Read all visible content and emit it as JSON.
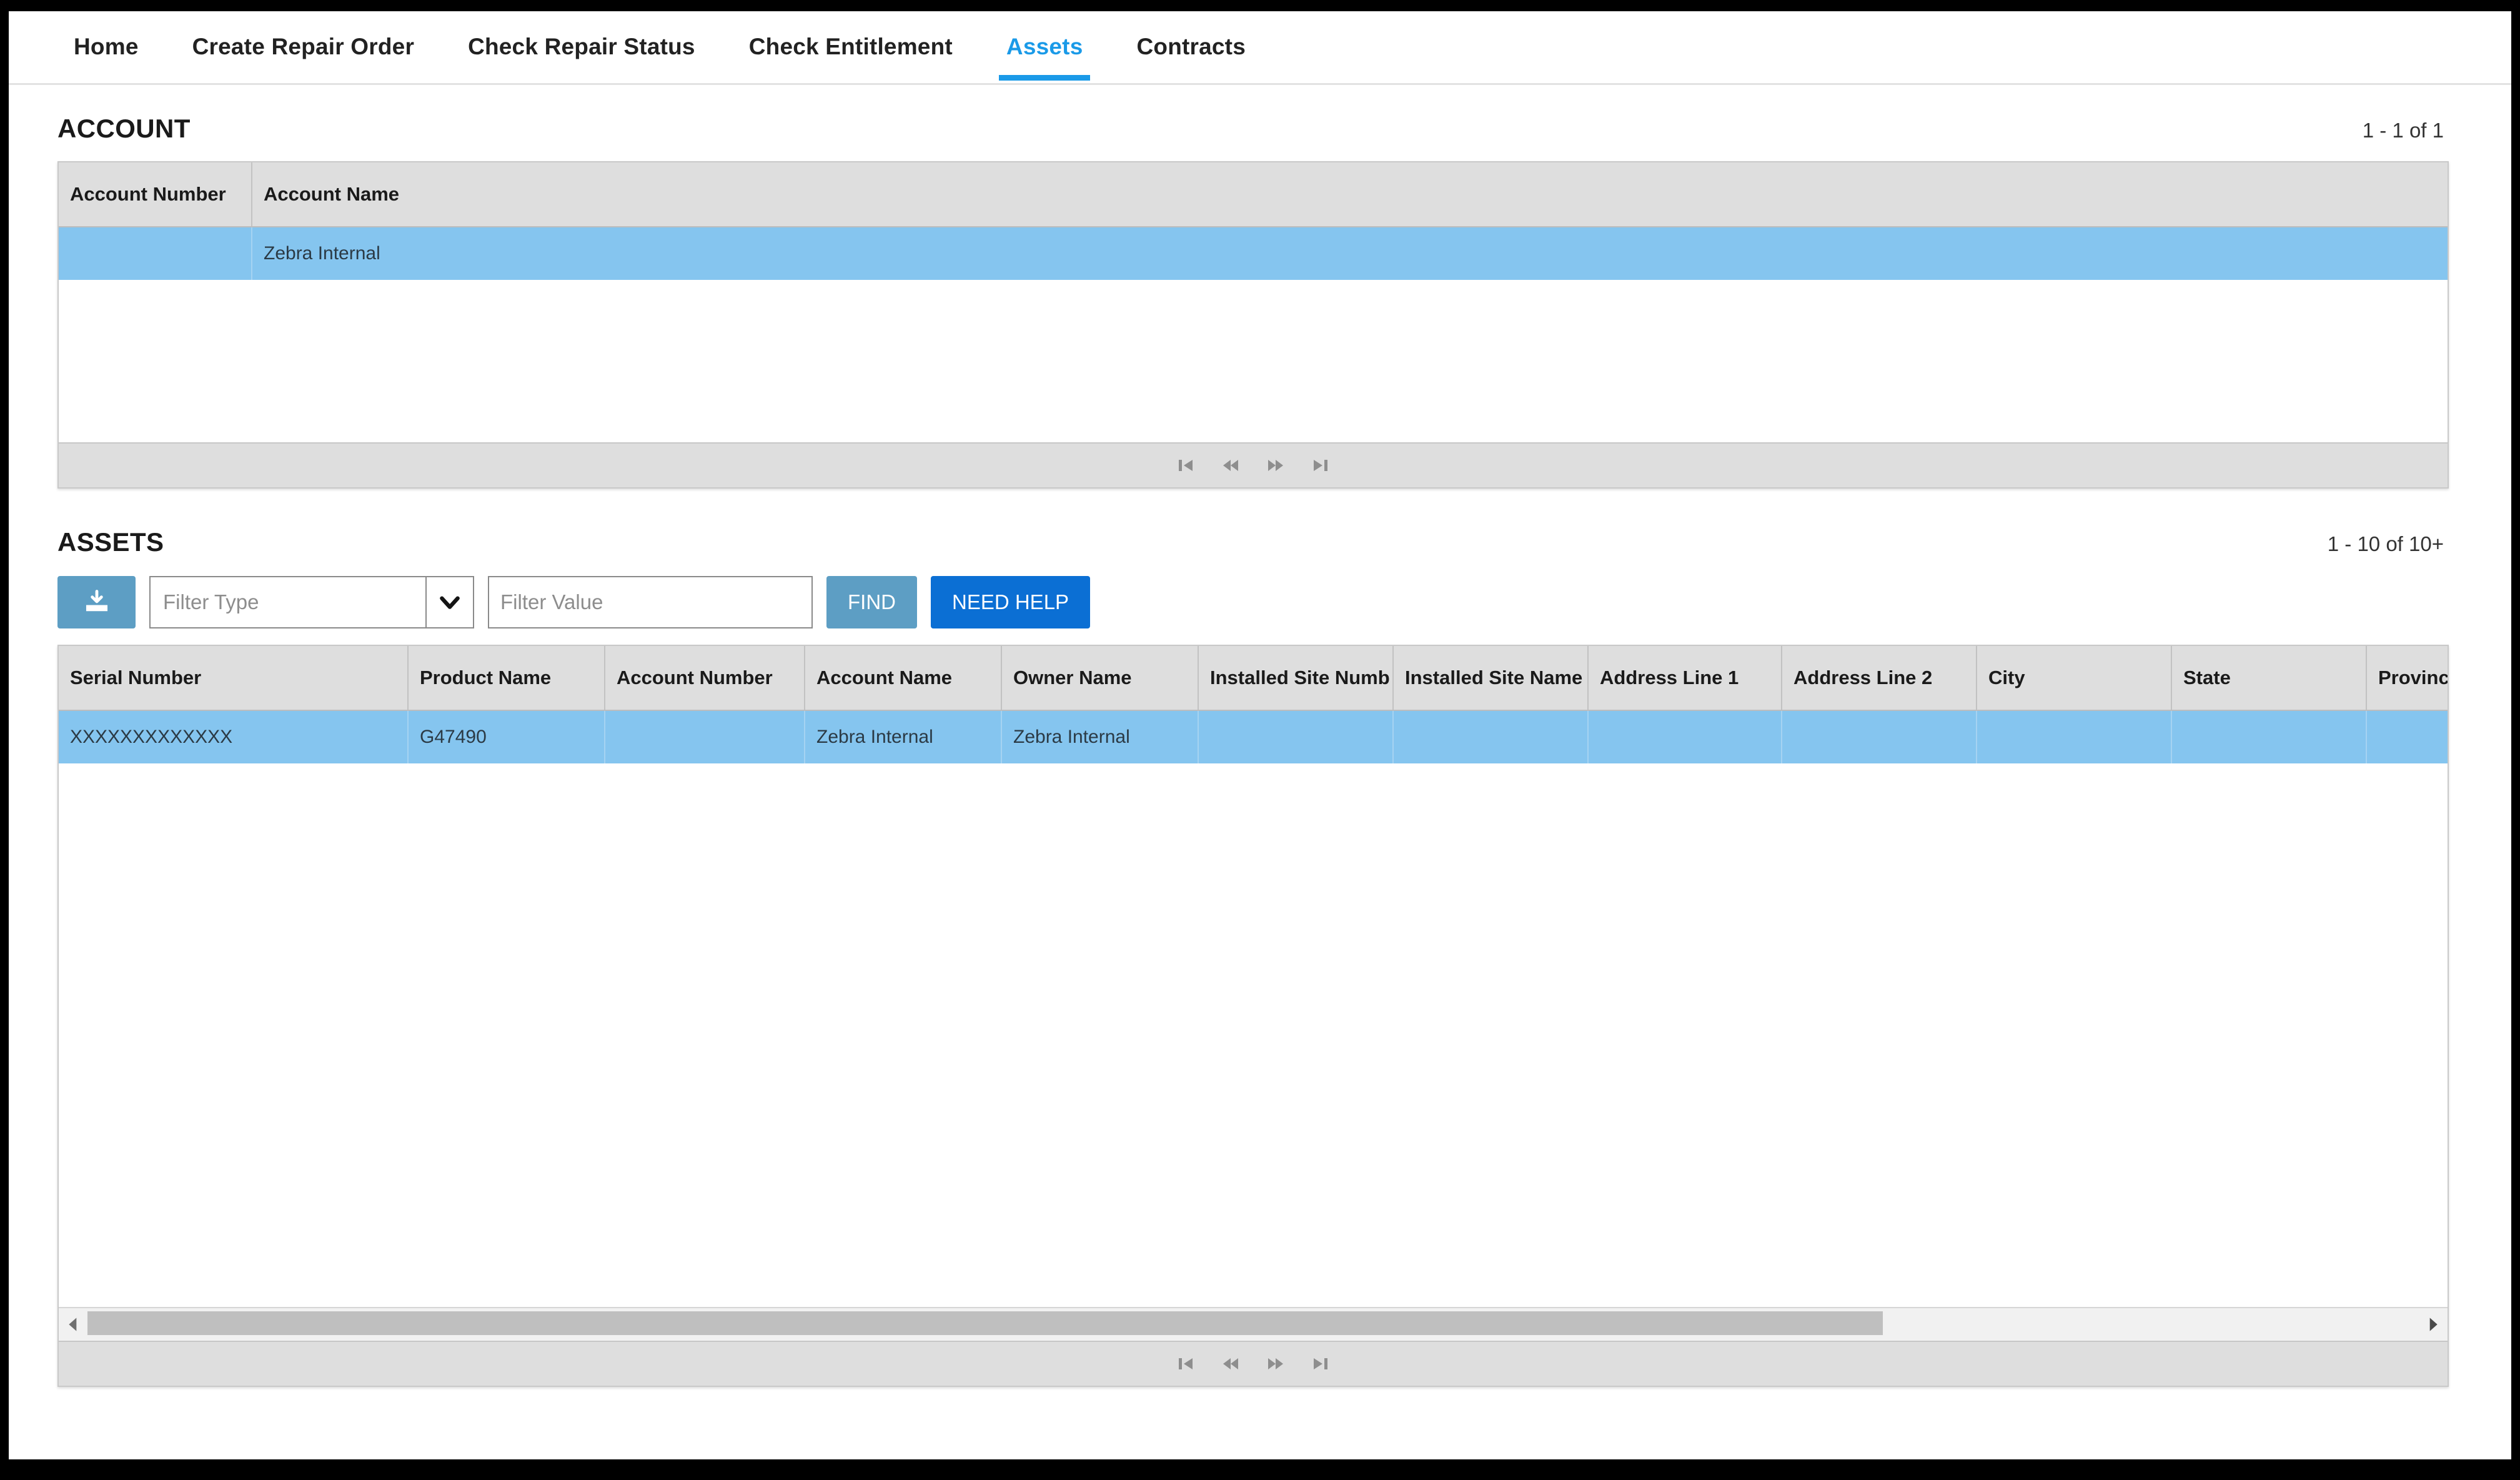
{
  "nav": {
    "items": [
      {
        "label": "Home",
        "active": false
      },
      {
        "label": "Create Repair Order",
        "active": false
      },
      {
        "label": "Check Repair Status",
        "active": false
      },
      {
        "label": "Check Entitlement",
        "active": false
      },
      {
        "label": "Assets",
        "active": true
      },
      {
        "label": "Contracts",
        "active": false
      }
    ]
  },
  "account_section": {
    "title": "ACCOUNT",
    "count": "1 - 1 of 1",
    "columns": [
      "Account Number",
      "Account Name"
    ],
    "rows": [
      {
        "account_number": "",
        "account_name": "Zebra Internal"
      }
    ]
  },
  "assets_section": {
    "title": "ASSETS",
    "count": "1 - 10 of 10+",
    "toolbar": {
      "export_icon": "download-icon",
      "filter_type_placeholder": "Filter Type",
      "filter_type_value": "",
      "filter_value_placeholder": "Filter Value",
      "filter_value_value": "",
      "find_label": "FIND",
      "need_help_label": "NEED HELP"
    },
    "columns": [
      "Serial Number",
      "Product Name",
      "Account Number",
      "Account Name",
      "Owner Name",
      "Installed Site Numb",
      "Installed Site Name",
      "Address Line 1",
      "Address Line 2",
      "City",
      "State",
      "Province"
    ],
    "rows": [
      {
        "serial_number": "XXXXXXXXXXXXX",
        "product_name": "G47490",
        "account_number": "",
        "account_name": "Zebra Internal",
        "owner_name": "Zebra Internal",
        "installed_site_number": "",
        "installed_site_name": "",
        "address_line_1": "",
        "address_line_2": "",
        "city": "",
        "state": "",
        "province": ""
      }
    ]
  },
  "pagination_icons": {
    "first": "first-page-icon",
    "previous": "previous-page-icon",
    "next": "next-page-icon",
    "last": "last-page-icon"
  },
  "colors": {
    "accent_blue": "#1a9ae8",
    "row_selected": "#85c5ef",
    "header_gray": "#dedede",
    "button_muted": "#5d9ec4",
    "button_primary": "#0b6fd4"
  }
}
